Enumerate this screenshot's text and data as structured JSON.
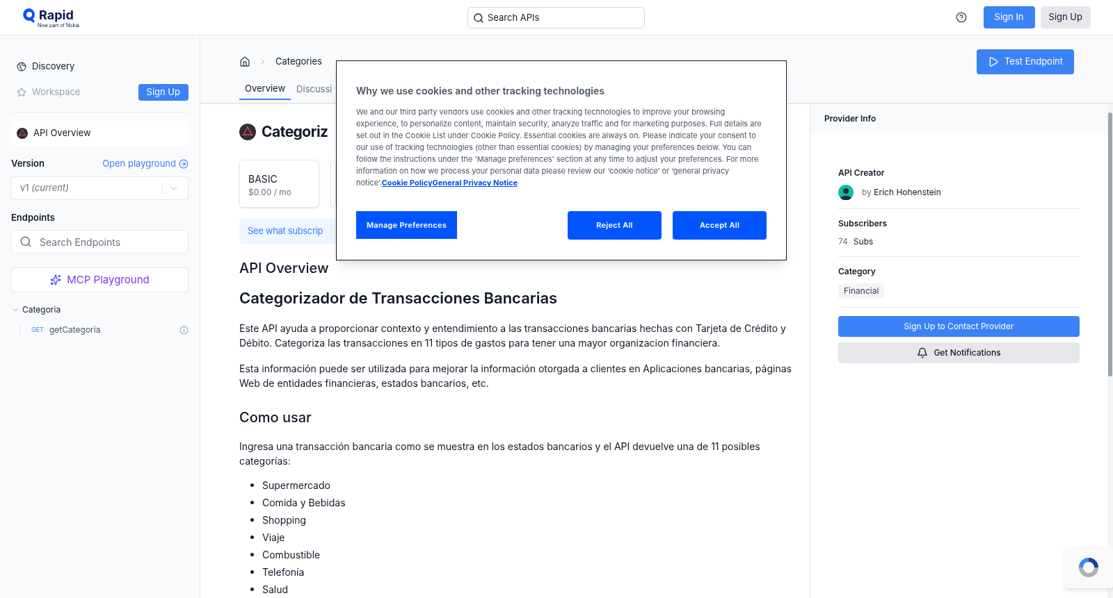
{
  "header": {
    "logo": "Rapid",
    "logo_sub": "Now part of Nokia",
    "search": {
      "placeholder": "Search APIs"
    },
    "sign_in": "Sign In",
    "sign_up": "Sign Up"
  },
  "sidebar": {
    "discovery": "Discovery",
    "workspace": "Workspace",
    "workspace_signup": "Sign Up",
    "api_overview": "API Overview",
    "version_label": "Version",
    "open_playground": "Open playground",
    "version": {
      "value": "v1",
      "note": "(current)"
    },
    "endpoints_label": "Endpoints",
    "endpoint_search": {
      "placeholder": "Search Endpoints"
    },
    "mcp": "MCP Playground",
    "groups": [
      {
        "name": "Categoria",
        "expanded": true,
        "children": [
          {
            "method": "GET",
            "name": "getCategoria"
          }
        ]
      }
    ]
  },
  "breadcrumb": [
    "Categories"
  ],
  "test_endpoint": "Test Endpoint",
  "tabs": [
    {
      "label": "Overview",
      "selected": true
    },
    {
      "label": "Discussi",
      "selected": false
    }
  ],
  "api_title": "Categoriz",
  "plans": [
    {
      "name": "BASIC",
      "price": "$0.00 / mo"
    }
  ],
  "subscription_note": "See what subscrip",
  "content": [
    {
      "kind": "h2",
      "text": "API Overview"
    },
    {
      "kind": "h1",
      "text": "Categorizador de Transacciones Bancarias"
    },
    {
      "kind": "p",
      "text": "Este API ayuda a proporcionar contexto y entendimiento a las transacciones bancarias hechas con Tarjeta de Crédito y Débito. Categoriza las transacciones en 11 tipos de gastos para tener una mayor organizacion financiera."
    },
    {
      "kind": "p",
      "text": "Esta información puede ser utilizada para mejorar la información otorgada a clientes en Aplicaciones bancarias, páginas Web de entidades financieras, estados bancarios, etc."
    },
    {
      "kind": "h2",
      "text": "Como usar"
    },
    {
      "kind": "p",
      "text": "Ingresa una transacción bancaria como se muestra en los estados bancarios y el API devuelve una de 11 posibles categorías:"
    },
    {
      "kind": "ul",
      "items": [
        "Supermercado",
        "Comida y Bebidas",
        "Shopping",
        "Viaje",
        "Combustible",
        "Telefonía",
        "Salud"
      ]
    }
  ],
  "provider": {
    "title": "Provider Info",
    "creator_label": "API Creator",
    "creator_by": "by",
    "creator": "Erich Hohenstein",
    "subscribers_label": "Subscribers",
    "subscribers": "74",
    "subs_unit": "Subs",
    "category_label": "Category",
    "category": "Financial",
    "contact": "Sign Up to Contact Provider",
    "notify": "Get Notifications"
  },
  "cookie": {
    "title": "Why we use cookies and other tracking technologies",
    "text": "We and our third party vendors use cookies and other tracking technologies to improve your browsing experience, to personalize content, maintain security, analyze traffic and for marketing purposes. Full details are set out in the Cookie List under Cookie Policy. Essential cookies are always on. Please indicate your consent to our use of tracking technologies (other than essential cookies) by managing your preferences below. You can follow the instructions under the 'Manage preferences' section at any time to adjust your preferences. For more information on how we process your personal data please review our ‘cookie notice’ or ‘general privacy notice’.",
    "link": "Cookie PolicyGeneral Privacy Notice",
    "manage": "Manage Preferences",
    "reject": "Reject All",
    "accept": "Accept All"
  }
}
